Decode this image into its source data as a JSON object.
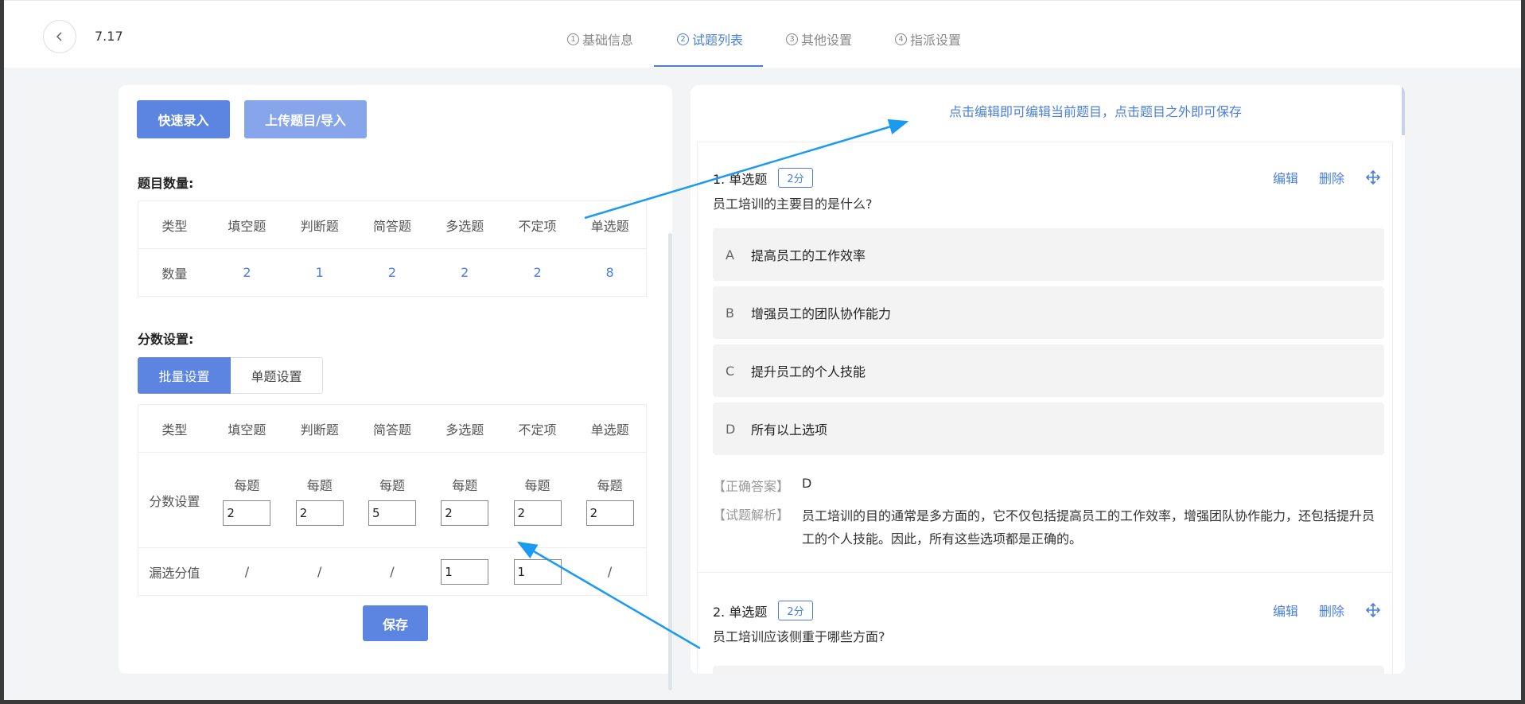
{
  "header": {
    "title": "7.17",
    "steps": [
      {
        "num": "1",
        "label": "基础信息"
      },
      {
        "num": "2",
        "label": "试题列表"
      },
      {
        "num": "3",
        "label": "其他设置"
      },
      {
        "num": "4",
        "label": "指派设置"
      }
    ],
    "active_step": "试题列表"
  },
  "left": {
    "quick_entry_label": "快速录入",
    "upload_label": "上传题目/导入",
    "count_section_label": "题目数量:",
    "count_table": {
      "headers": [
        "类型",
        "填空题",
        "判断题",
        "简答题",
        "多选题",
        "不定项",
        "单选题"
      ],
      "row_label": "数量",
      "values": [
        "2",
        "1",
        "2",
        "2",
        "2",
        "8"
      ]
    },
    "score_section_label": "分数设置:",
    "score_tabs": [
      "批量设置",
      "单题设置"
    ],
    "active_score_tab": "批量设置",
    "score_table": {
      "headers": [
        "类型",
        "填空题",
        "判断题",
        "简答题",
        "多选题",
        "不定项",
        "单选题"
      ],
      "score_row_label": "分数设置",
      "per_label": "每题",
      "scores": [
        "2",
        "2",
        "5",
        "2",
        "2",
        "2"
      ],
      "miss_row_label": "漏选分值",
      "miss_values": [
        "/",
        "/",
        "/",
        "1",
        "1",
        "/"
      ]
    },
    "save_label": "保存"
  },
  "right": {
    "hint": "点击编辑即可编辑当前题目，点击题目之外即可保存",
    "questions": [
      {
        "index_type": "1. 单选题",
        "score": "2分",
        "edit": "编辑",
        "delete": "删除",
        "stem": "员工培训的主要目的是什么?",
        "options": [
          {
            "letter": "A",
            "text": "提高员工的工作效率"
          },
          {
            "letter": "B",
            "text": "增强员工的团队协作能力"
          },
          {
            "letter": "C",
            "text": "提升员工的个人技能"
          },
          {
            "letter": "D",
            "text": "所有以上选项"
          }
        ],
        "answer_label": "【正确答案】",
        "answer": "D",
        "analysis_label": "【试题解析】",
        "analysis": "员工培训的目的通常是多方面的，它不仅包括提高员工的工作效率，增强团队协作能力，还包括提升员工的个人技能。因此，所有这些选项都是正确的。"
      },
      {
        "index_type": "2. 单选题",
        "score": "2分",
        "edit": "编辑",
        "delete": "删除",
        "stem": "员工培训应该侧重于哪些方面?"
      }
    ]
  },
  "colors": {
    "accent": "#4a7fe0",
    "primary_button": "#5b85e0",
    "annotation_arrow": "#1a9af0"
  },
  "icons": [
    "chevron-left-icon",
    "move-icon",
    "step-number-circle"
  ]
}
